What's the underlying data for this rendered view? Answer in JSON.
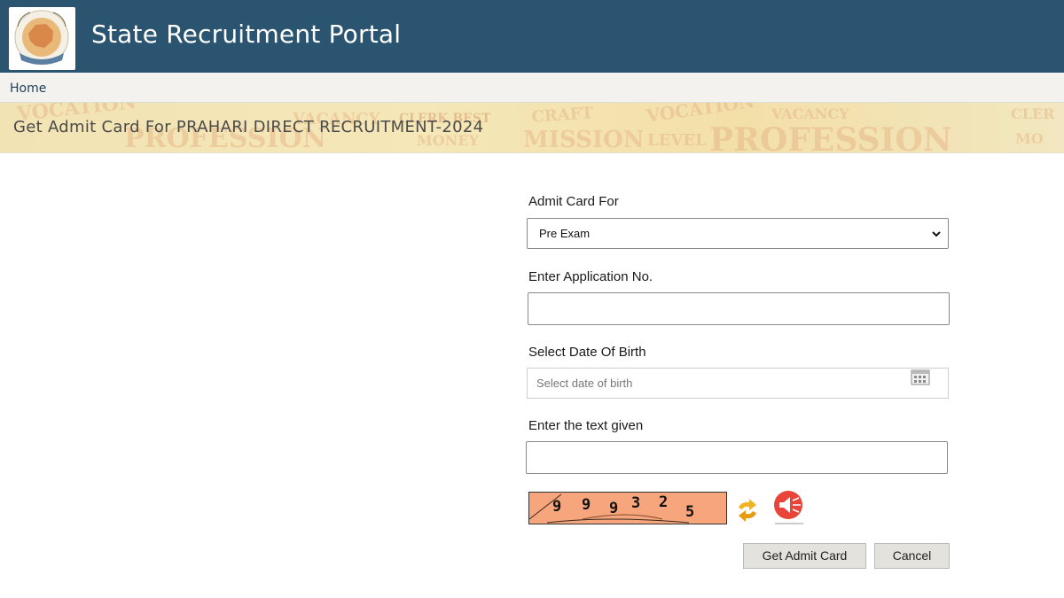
{
  "header": {
    "title": "State Recruitment Portal",
    "logo_icon": "rajasthan-state-emblem"
  },
  "nav": {
    "home": "Home"
  },
  "banner": {
    "title": "Get Admit Card For PRAHARI DIRECT RECRUITMENT-2024"
  },
  "form": {
    "admit_card_for_label": "Admit Card For",
    "admit_card_for_value": "Pre Exam",
    "application_no_label": "Enter Application No.",
    "application_no_value": "",
    "dob_label": "Select Date Of Birth",
    "dob_placeholder": "Select date of birth",
    "captcha_label": "Enter the text given",
    "captcha_input_value": "",
    "captcha_text": "9 9 9 3 2 5",
    "submit_label": "Get Admit Card",
    "cancel_label": "Cancel"
  },
  "colors": {
    "header_bg": "#2b5470",
    "nav_bg": "#f3f2ef",
    "captcha_bg": "#f7a57c",
    "button_bg": "#e4e2dd"
  }
}
